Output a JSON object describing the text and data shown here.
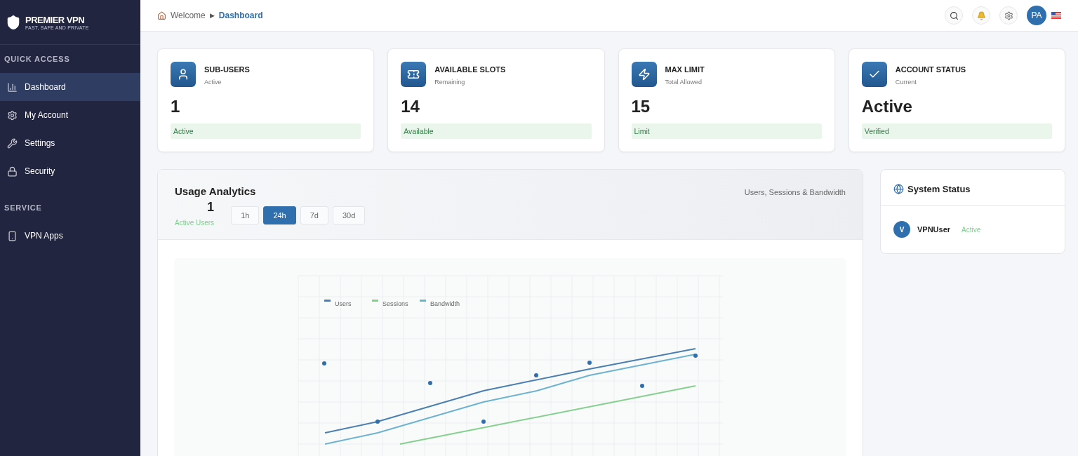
{
  "brand": {
    "name": "PREMIER VPN",
    "tagline": "FAST, SAFE AND PRIVATE"
  },
  "sidebar": {
    "sections": [
      {
        "title": "QUICK ACCESS",
        "items": [
          {
            "label": "Dashboard",
            "selected": true
          },
          {
            "label": "My Account",
            "selected": false
          },
          {
            "label": "Settings",
            "selected": false
          },
          {
            "label": "Security",
            "selected": false
          }
        ]
      },
      {
        "title": "SERVICE",
        "items": [
          {
            "label": "VPN Apps",
            "selected": false
          }
        ]
      }
    ]
  },
  "breadcrumb": {
    "parent": "Welcome",
    "separator": "▶",
    "current": "Dashboard"
  },
  "header": {
    "avatar": "PA"
  },
  "stat_cards": [
    {
      "title": "SUB-USERS",
      "subtitle": "Active",
      "value": "1",
      "badge": "Active"
    },
    {
      "title": "AVAILABLE SLOTS",
      "subtitle": "Remaining",
      "value": "14",
      "badge": "Available"
    },
    {
      "title": "MAX LIMIT",
      "subtitle": "Total Allowed",
      "value": "15",
      "badge": "Limit"
    },
    {
      "title": "ACCOUNT STATUS",
      "subtitle": "Current",
      "value": "Active",
      "badge": "Verified"
    }
  ],
  "analytics": {
    "title": "Usage Analytics",
    "count": "1",
    "count_label": "Active Users",
    "subtitle": "Users, Sessions & Bandwidth",
    "ranges": [
      {
        "label": "1h",
        "selected": false
      },
      {
        "label": "24h",
        "selected": true
      },
      {
        "label": "7d",
        "selected": false
      },
      {
        "label": "30d",
        "selected": false
      }
    ],
    "legend": [
      {
        "label": "Users",
        "color": "#4a7fb0"
      },
      {
        "label": "Sessions",
        "color": "#86d08f"
      },
      {
        "label": "Bandwidth",
        "color": "#6db3cf"
      }
    ]
  },
  "system_status": {
    "title": "System Status",
    "users": [
      {
        "initial": "V",
        "name": "VPNUser",
        "status": "Active"
      }
    ]
  }
}
